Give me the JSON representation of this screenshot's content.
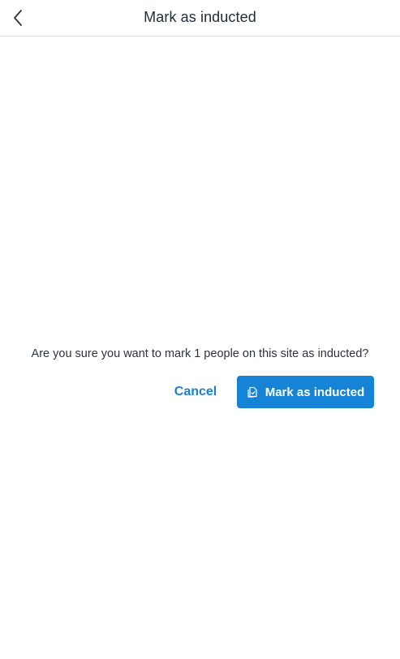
{
  "header": {
    "title": "Mark as inducted",
    "back_icon": "chevron-left-icon"
  },
  "dialog": {
    "message": "Are you sure you want to mark 1 people on this site as inducted?",
    "cancel_label": "Cancel",
    "confirm_label": "Mark as inducted",
    "confirm_icon": "document-check-icon"
  },
  "colors": {
    "accent": "#1684d6",
    "link": "#1b7fd1",
    "title_text": "#1f2a3a",
    "divider": "#dcdfe3"
  }
}
